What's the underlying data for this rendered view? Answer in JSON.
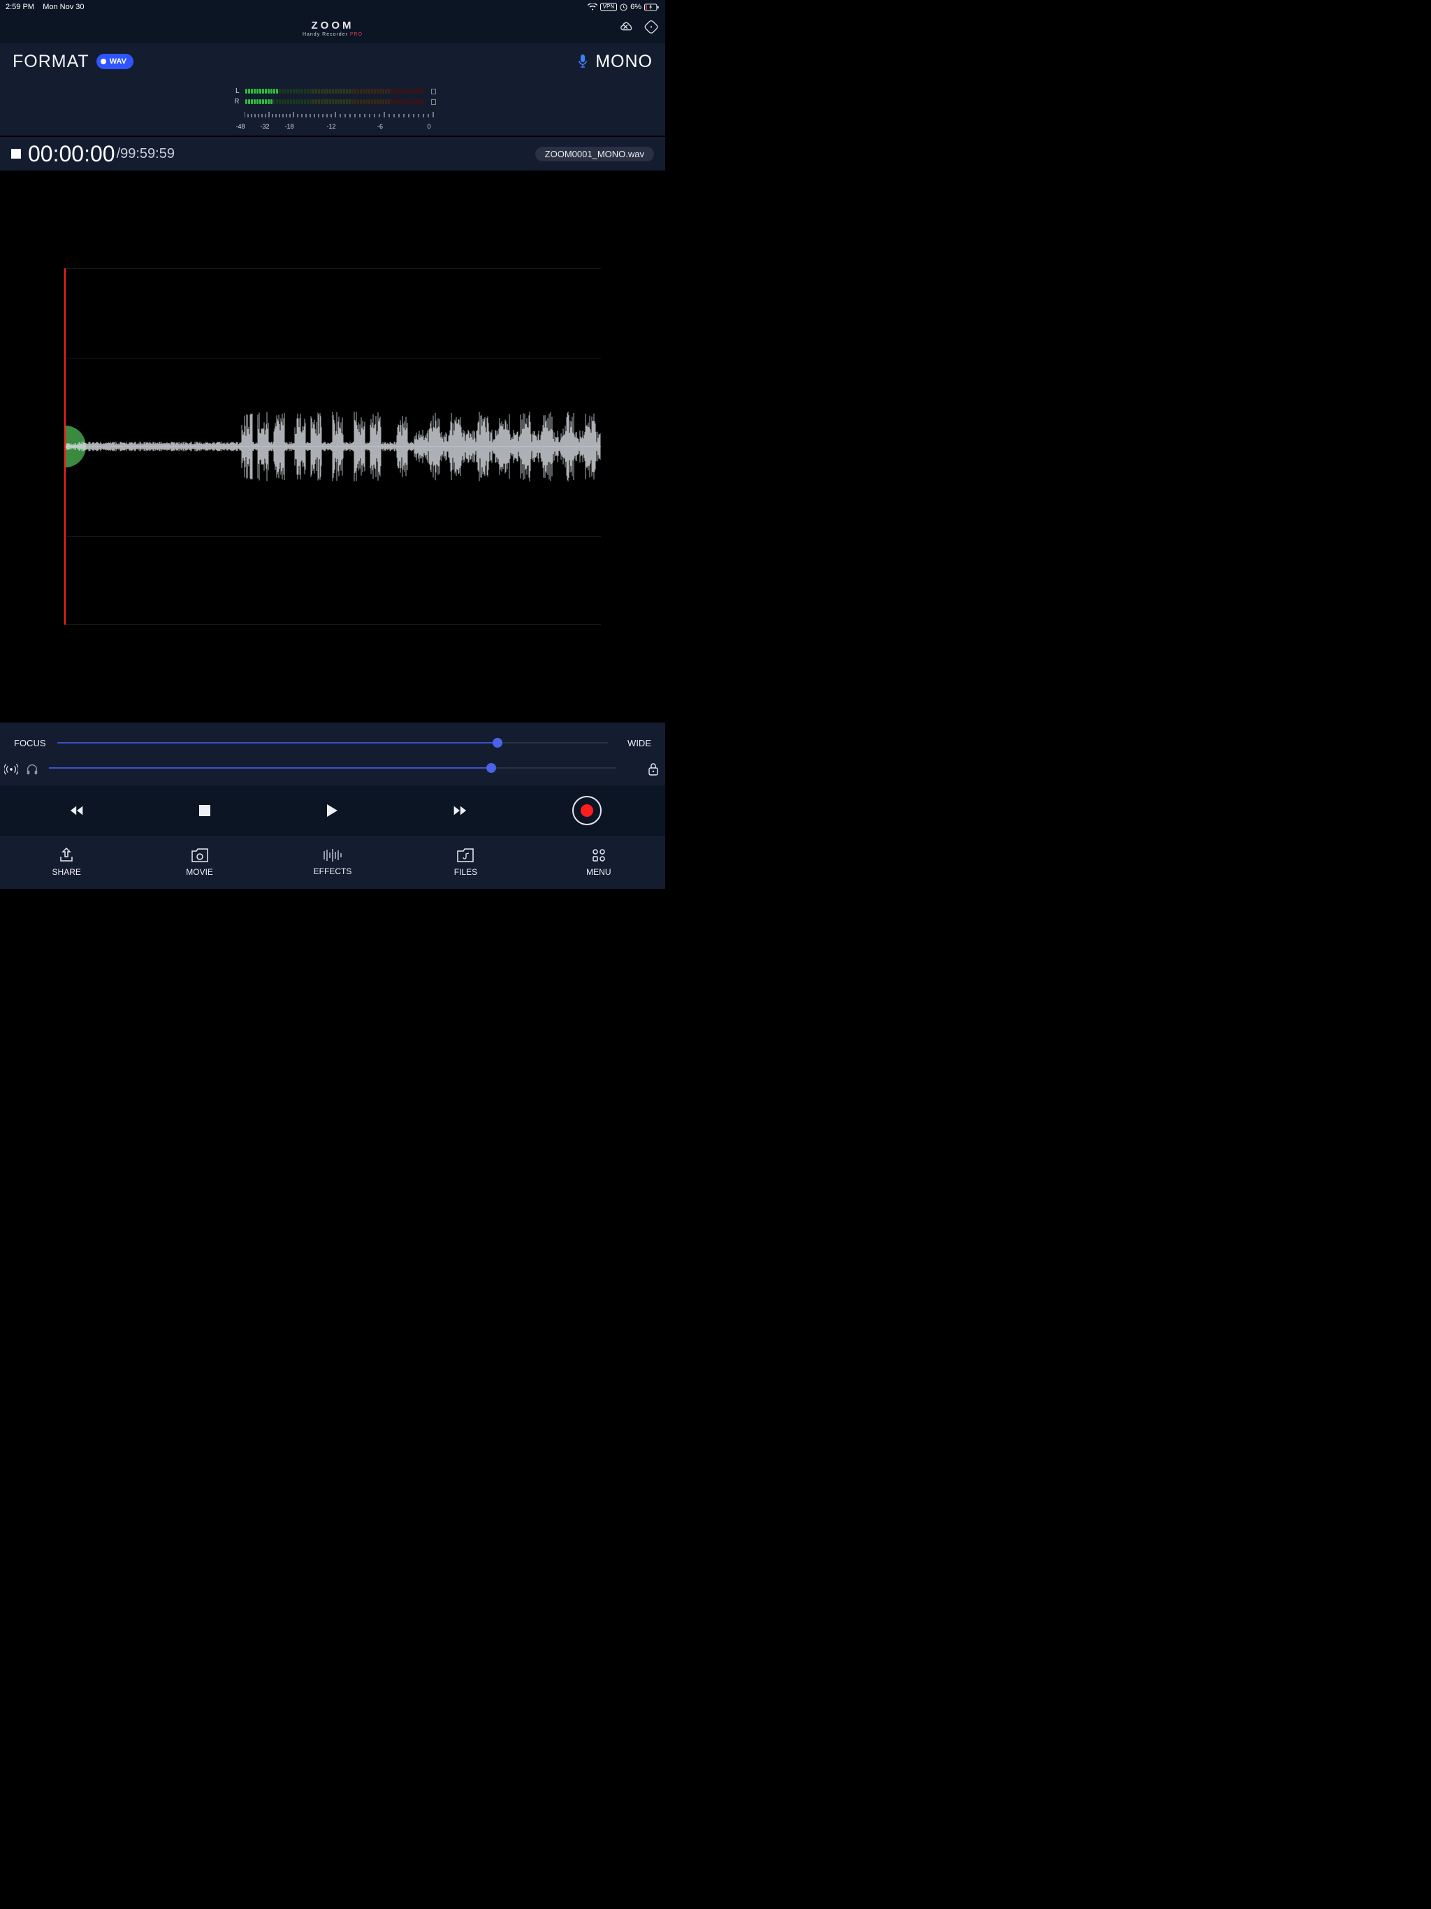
{
  "status": {
    "time": "2:59 PM",
    "date": "Mon Nov 30",
    "vpn": "VPN",
    "battery_pct": "6%"
  },
  "app": {
    "logo_text": "ZOOM",
    "subtitle": "Handy Recorder",
    "subtitle_suffix": "PRO"
  },
  "format": {
    "label": "FORMAT",
    "badge": "WAV",
    "channel_mode": "MONO"
  },
  "meter": {
    "left_label": "L",
    "right_label": "R",
    "scale": [
      "-48",
      "-32",
      "-18",
      "-12",
      "-6",
      "0"
    ]
  },
  "timebar": {
    "current": "00:00:00",
    "max": "/99:59:59",
    "filename": "ZOOM0001_MONO.wav"
  },
  "sliders": {
    "focus_label": "FOCUS",
    "wide_label": "WIDE",
    "focus_value_pct": 80,
    "monitor_value_pct": 78
  },
  "nav": {
    "share": "SHARE",
    "movie": "MOVIE",
    "effects": "EFFECTS",
    "files": "FILES",
    "menu": "MENU"
  },
  "icons": {
    "cloud": "cloud-off-icon",
    "rotation": "rotation-lock-icon",
    "mic": "microphone-icon",
    "broadcast": "broadcast-icon",
    "headphones": "headphones-icon",
    "lock": "lock-icon"
  }
}
